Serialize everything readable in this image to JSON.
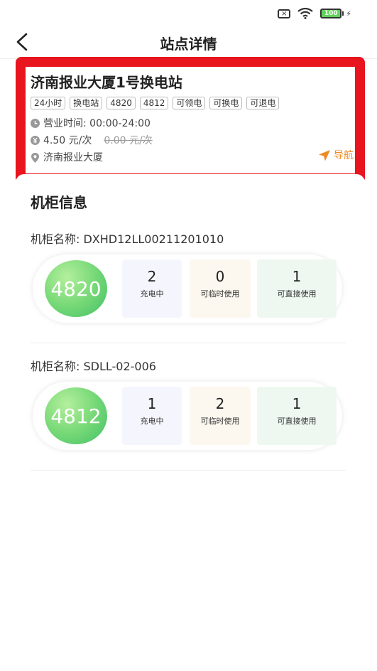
{
  "status_bar": {
    "sim_icon": "sim-x-icon",
    "wifi_icon": "wifi-icon",
    "battery_level": "100",
    "charging_icon": "bolt-icon"
  },
  "header": {
    "title": "站点详情",
    "back_icon": "chevron-left-icon"
  },
  "station": {
    "name": "济南报业大厦1号换电站",
    "tags": [
      "24小时",
      "换电站",
      "4820",
      "4812",
      "可领电",
      "可换电",
      "可退电"
    ],
    "hours_label": "营业时间: 00:00-24:00",
    "price": "4.50 元/次",
    "original_price": "0.00 元/次",
    "address": "济南报业大厦",
    "navigate_label": "导航",
    "accent_color": "#f08a24",
    "highlight_color": "#e8141e"
  },
  "main": {
    "section_title": "机柜信息",
    "cabinets": [
      {
        "name": "机柜名称: DXHD12LL00211201010",
        "model": "4820",
        "stats": [
          {
            "value": "2",
            "label": "充电中"
          },
          {
            "value": "0",
            "label": "可临时使用"
          },
          {
            "value": "1",
            "label": "可直接使用"
          }
        ]
      },
      {
        "name": "机柜名称: SDLL-02-006",
        "model": "4812",
        "stats": [
          {
            "value": "1",
            "label": "充电中"
          },
          {
            "value": "2",
            "label": "可临时使用"
          },
          {
            "value": "1",
            "label": "可直接使用"
          }
        ]
      }
    ]
  }
}
